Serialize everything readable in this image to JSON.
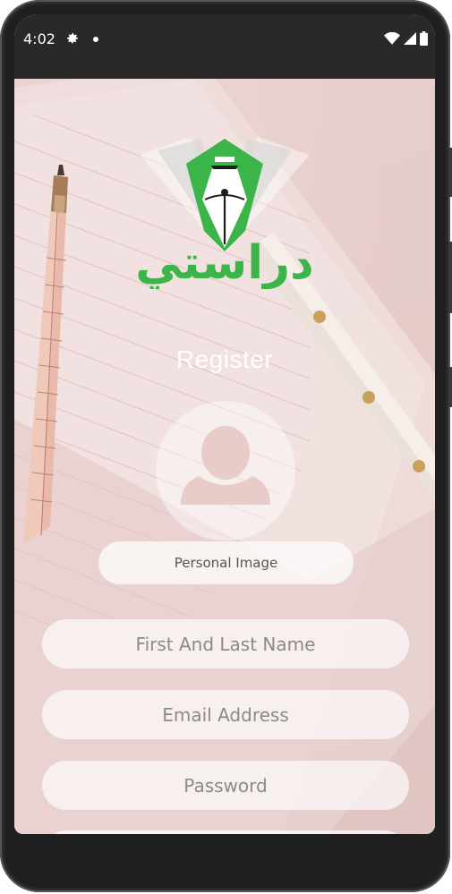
{
  "status_bar": {
    "time": "4:02",
    "icons": [
      "gear-icon",
      "notification-dot",
      "wifi-icon",
      "signal-icon",
      "battery-icon"
    ]
  },
  "logo": {
    "arabic_text": "دراستي",
    "colors": {
      "green": "#3bb54a",
      "gray": "#d9d9d9"
    }
  },
  "register": {
    "title": "Register",
    "personal_image_label": "Personal Image",
    "fields": {
      "name_placeholder": "First And Last Name",
      "email_placeholder": "Email Address",
      "password_placeholder": "Password",
      "confirm_placeholder": ""
    }
  }
}
